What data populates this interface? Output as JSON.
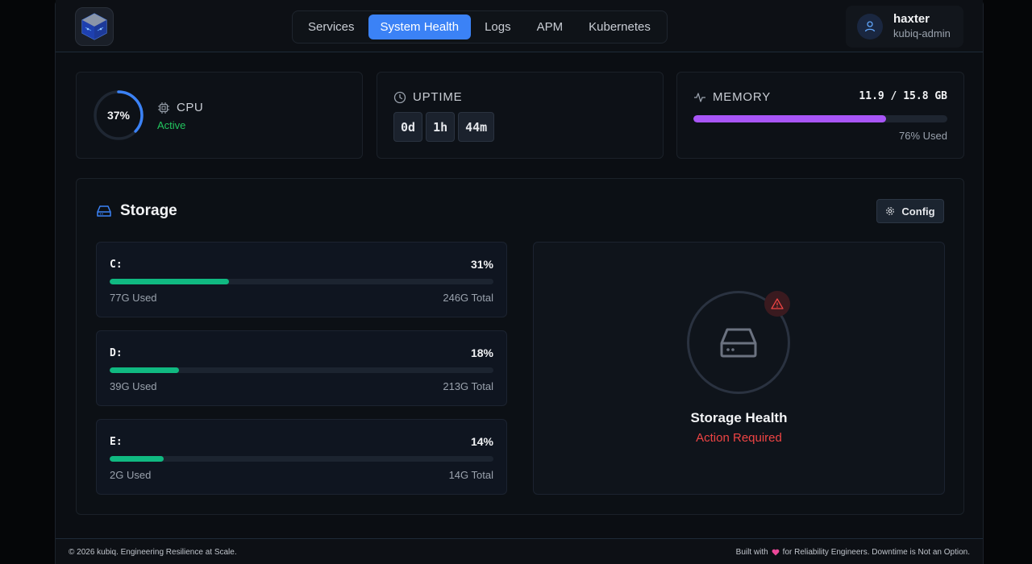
{
  "nav": {
    "items": [
      {
        "label": "Services",
        "active": false
      },
      {
        "label": "System Health",
        "active": true
      },
      {
        "label": "Logs",
        "active": false
      },
      {
        "label": "APM",
        "active": false
      },
      {
        "label": "Kubernetes",
        "active": false
      }
    ]
  },
  "user": {
    "name": "haxter",
    "role": "kubiq-admin",
    "icon": "user-icon"
  },
  "cpu": {
    "percent_label": "37%",
    "percent": 37,
    "label": "CPU",
    "status": "Active",
    "color": "#3b82f6"
  },
  "uptime": {
    "label": "UPTIME",
    "days": "0d",
    "hours": "1h",
    "minutes": "44m"
  },
  "memory": {
    "label": "MEMORY",
    "value": "11.9 / 15.8 GB",
    "used_label": "76% Used",
    "fraction": 0.76,
    "color": "#a855f7"
  },
  "storage": {
    "title": "Storage",
    "config_label": "Config",
    "drives": [
      {
        "name": "C:",
        "percent_label": "31%",
        "fraction": 0.31,
        "used": "77G Used",
        "total": "246G Total"
      },
      {
        "name": "D:",
        "percent_label": "18%",
        "fraction": 0.18,
        "used": "39G Used",
        "total": "213G Total"
      },
      {
        "name": "E:",
        "percent_label": "14%",
        "fraction": 0.14,
        "used": "2G Used",
        "total": "14G Total"
      }
    ],
    "health": {
      "title": "Storage Health",
      "status": "Action Required",
      "status_color": "#ef4444"
    }
  },
  "footer": {
    "left": "© 2026 kubiq. Engineering Resilience at Scale.",
    "right_prefix": "Built with",
    "right_suffix": "for Reliability Engineers. Downtime is Not an Option."
  }
}
